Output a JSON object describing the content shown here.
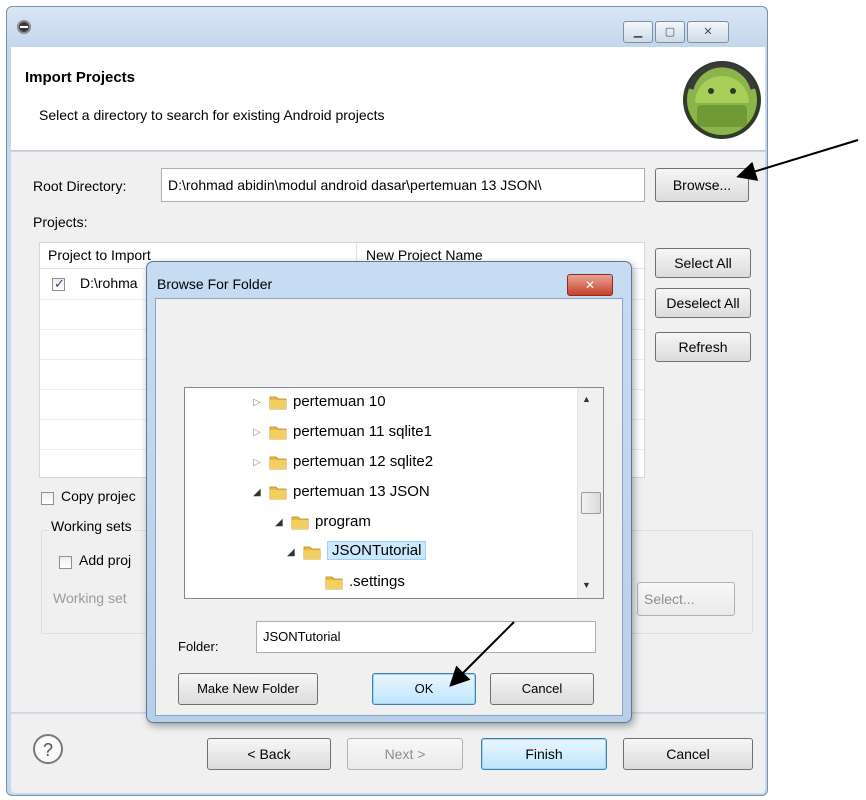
{
  "window": {
    "title": "",
    "header_title": "Import Projects",
    "header_subtitle": "Select a directory to search for existing Android projects",
    "root_directory_label": "Root Directory:",
    "root_directory_value": "D:\\rohmad abidin\\modul android dasar\\pertemuan 13 JSON\\",
    "browse_label": "Browse...",
    "projects_label": "Projects:",
    "table": {
      "columns": [
        "Project to Import",
        "New Project Name"
      ],
      "rows": [
        {
          "checked": true,
          "project": "D:\\rohma"
        }
      ]
    },
    "select_all_label": "Select All",
    "deselect_all_label": "Deselect All",
    "refresh_label": "Refresh",
    "copy_projects_label": "Copy projec",
    "working_sets_label": "Working sets",
    "add_project_label": "Add proj",
    "working_set_field_label": "Working set",
    "select_label": "Select...",
    "footer": {
      "back_label": "< Back",
      "next_label": "Next >",
      "finish_label": "Finish",
      "cancel_label": "Cancel"
    }
  },
  "dialog": {
    "title": "Browse For Folder",
    "close_glyph": "✕",
    "tree": [
      {
        "label": "pertemuan 10",
        "expanded": false,
        "depth": 0
      },
      {
        "label": "pertemuan 11 sqlite1",
        "expanded": false,
        "depth": 0
      },
      {
        "label": "pertemuan 12 sqlite2",
        "expanded": false,
        "depth": 0
      },
      {
        "label": "pertemuan 13 JSON",
        "expanded": true,
        "depth": 0
      },
      {
        "label": "program",
        "expanded": true,
        "depth": 1
      },
      {
        "label": "JSONTutorial",
        "expanded": true,
        "depth": 2,
        "selected": true
      },
      {
        "label": ".settings",
        "expanded": false,
        "depth": 3
      }
    ],
    "folder_label": "Folder:",
    "folder_value": "JSONTutorial",
    "make_new_folder_label": "Make New Folder",
    "ok_label": "OK",
    "cancel_label": "Cancel"
  },
  "colors": {
    "window_frame": "#c5d8ee",
    "folder_yellow": "#e8b93a",
    "selection": "#cce8ff"
  }
}
